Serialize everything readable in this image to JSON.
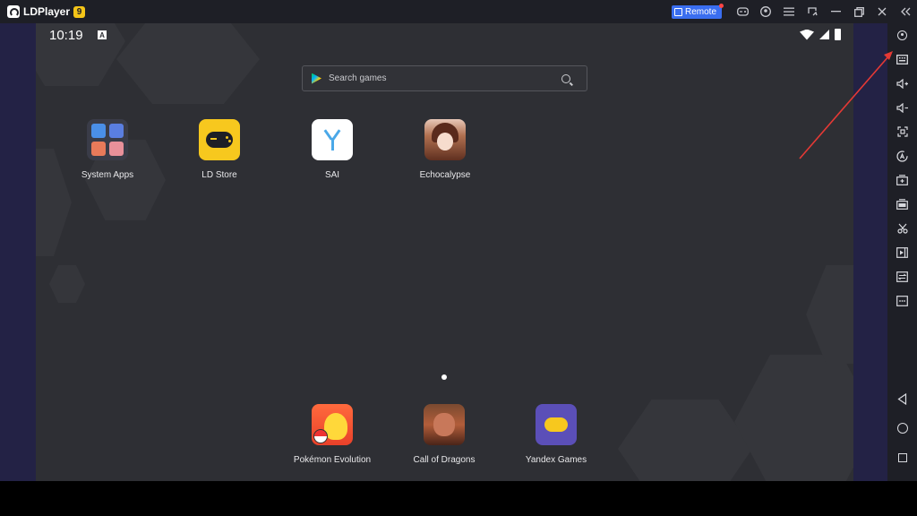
{
  "titlebar": {
    "app_name": "LDPlayer",
    "version_badge": "9",
    "remote_label": "Remote",
    "icons": [
      "gamepad-icon",
      "account-icon",
      "menu-icon",
      "sync-icon",
      "minimize-icon",
      "restore-icon",
      "close-icon",
      "collapse-sidebar-icon"
    ]
  },
  "status_bar": {
    "time": "10:19",
    "notification_letter": "A"
  },
  "search": {
    "placeholder": "Search games"
  },
  "apps": [
    {
      "label": "System Apps"
    },
    {
      "label": "LD Store"
    },
    {
      "label": "SAI"
    },
    {
      "label": "Echocalypse"
    }
  ],
  "dock": [
    {
      "label": "Pokémon Evolution"
    },
    {
      "label": "Call of Dragons"
    },
    {
      "label": "Yandex Games"
    }
  ],
  "toolbar": {
    "icons": [
      "settings-icon",
      "keyboard-mapping-icon",
      "volume-up-icon",
      "volume-down-icon",
      "screenshot-icon",
      "rotate-icon",
      "add-apk-icon",
      "apk-install-icon",
      "scissors-icon",
      "video-record-icon",
      "sync-operation-icon",
      "more-icon",
      "back-nav-icon",
      "home-nav-icon",
      "recent-apps-icon"
    ]
  },
  "colors": {
    "accent_remote": "#3a6ef0",
    "version_badge": "#f5c518",
    "arrow": "#e53935",
    "screen_bg": "#2e2f34",
    "frame_bg": "#1e1f26"
  }
}
